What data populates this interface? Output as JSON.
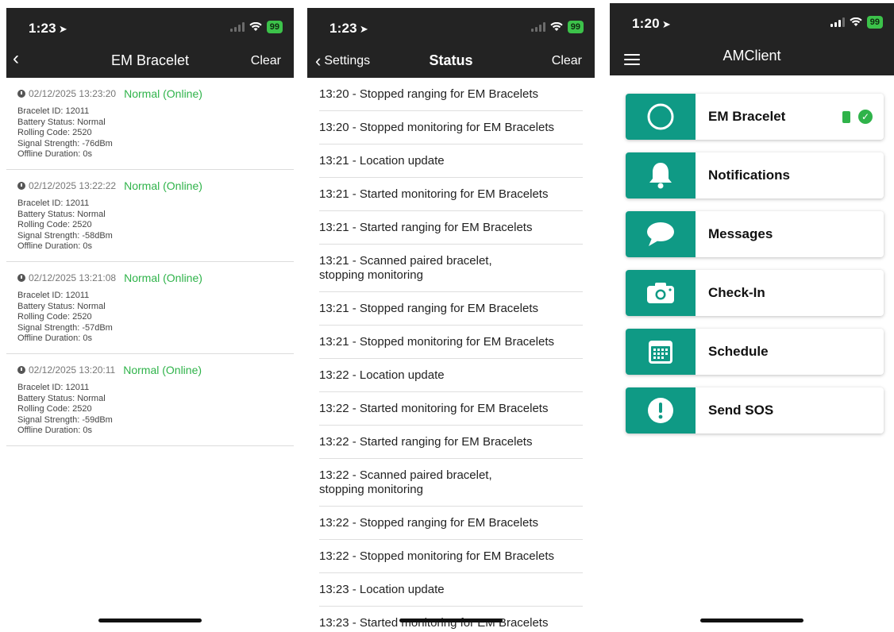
{
  "phone1": {
    "status_time": "1:23",
    "battery": "99",
    "title": "EM Bracelet",
    "right_action": "Clear",
    "entries": [
      {
        "timestamp": "02/12/2025 13:23:20",
        "state": "Normal (Online)",
        "bracelet_id": "Bracelet ID: 12011",
        "battery": "Battery Status: Normal",
        "rolling": "Rolling Code: 2520",
        "signal": "Signal Strength: -76dBm",
        "offline": "Offline Duration: 0s"
      },
      {
        "timestamp": "02/12/2025 13:22:22",
        "state": "Normal (Online)",
        "bracelet_id": "Bracelet ID: 12011",
        "battery": "Battery Status: Normal",
        "rolling": "Rolling Code: 2520",
        "signal": "Signal Strength: -58dBm",
        "offline": "Offline Duration: 0s"
      },
      {
        "timestamp": "02/12/2025 13:21:08",
        "state": "Normal (Online)",
        "bracelet_id": "Bracelet ID: 12011",
        "battery": "Battery Status: Normal",
        "rolling": "Rolling Code: 2520",
        "signal": "Signal Strength: -57dBm",
        "offline": "Offline Duration: 0s"
      },
      {
        "timestamp": "02/12/2025 13:20:11",
        "state": "Normal (Online)",
        "bracelet_id": "Bracelet ID: 12011",
        "battery": "Battery Status: Normal",
        "rolling": "Rolling Code: 2520",
        "signal": "Signal Strength: -59dBm",
        "offline": "Offline Duration: 0s"
      }
    ]
  },
  "phone2": {
    "status_time": "1:23",
    "battery": "99",
    "back_label": "Settings",
    "title": "Status",
    "right_action": "Clear",
    "rows": [
      {
        "l1": "13:20 - Stopped ranging for EM Bracelets"
      },
      {
        "l1": "13:20 - Stopped monitoring for EM Bracelets"
      },
      {
        "l1": "13:21 - Location update"
      },
      {
        "l1": "13:21 - Started monitoring for EM Bracelets"
      },
      {
        "l1": "13:21 - Started ranging for EM Bracelets"
      },
      {
        "l1": "13:21 - Scanned paired bracelet,",
        "l2": "stopping monitoring"
      },
      {
        "l1": "13:21 - Stopped ranging for EM Bracelets"
      },
      {
        "l1": "13:21 - Stopped monitoring for EM Bracelets"
      },
      {
        "l1": "13:22 - Location update"
      },
      {
        "l1": "13:22 - Started monitoring for EM Bracelets"
      },
      {
        "l1": "13:22 - Started ranging for EM Bracelets"
      },
      {
        "l1": "13:22 - Scanned paired bracelet,",
        "l2": "stopping monitoring"
      },
      {
        "l1": "13:22 - Stopped ranging for EM Bracelets"
      },
      {
        "l1": "13:22 - Stopped monitoring for EM Bracelets"
      },
      {
        "l1": "13:23 - Location update"
      },
      {
        "l1": "13:23 - Started monitoring for EM Bracelets"
      }
    ]
  },
  "phone3": {
    "status_time": "1:20",
    "battery": "99",
    "title": "AMClient",
    "menu": [
      {
        "label": "EM Bracelet",
        "icon": "circle-icon"
      },
      {
        "label": "Notifications",
        "icon": "bell-icon"
      },
      {
        "label": "Messages",
        "icon": "chat-bubble-icon"
      },
      {
        "label": "Check-In",
        "icon": "camera-icon"
      },
      {
        "label": "Schedule",
        "icon": "calendar-icon"
      },
      {
        "label": "Send SOS",
        "icon": "exclamation-icon"
      }
    ]
  },
  "colors": {
    "accent": "#0f9a85",
    "online": "#2fb34a",
    "topbar": "#232323"
  }
}
